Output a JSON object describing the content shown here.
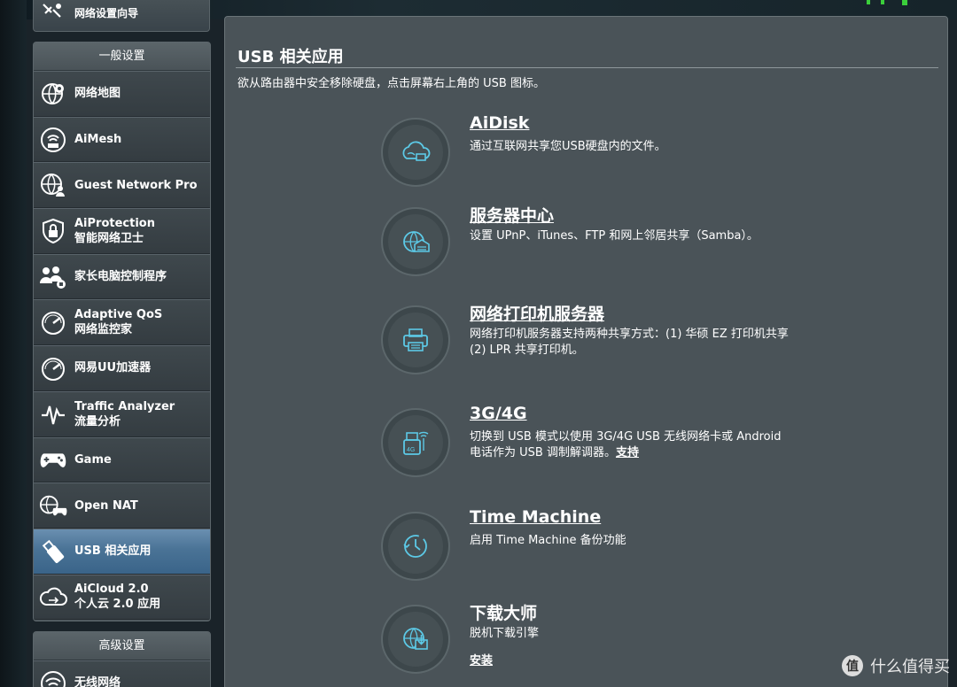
{
  "sidebar": {
    "top_item": {
      "label": "网络设置向导",
      "icon": "wizard-icon"
    },
    "general_header": "一般设置",
    "items": [
      {
        "label": "网络地图",
        "icon": "globe-map-icon"
      },
      {
        "label": "AiMesh",
        "icon": "mesh-router-icon"
      },
      {
        "label": "Guest Network Pro",
        "icon": "guest-globe-icon"
      },
      {
        "label": "AiProtection\n智能网络卫士",
        "icon": "shield-lock-icon"
      },
      {
        "label": "家长电脑控制程序",
        "icon": "family-icon"
      },
      {
        "label": "Adaptive QoS\n网络监控家",
        "icon": "speedometer-icon"
      },
      {
        "label": "网易UU加速器",
        "icon": "speedometer-icon"
      },
      {
        "label": "Traffic Analyzer\n流量分析",
        "icon": "pulse-icon"
      },
      {
        "label": "Game",
        "icon": "gamepad-icon"
      },
      {
        "label": "Open NAT",
        "icon": "gamepad-globe-icon"
      },
      {
        "label": "USB 相关应用",
        "icon": "usb-icon",
        "active": true
      },
      {
        "label": "AiCloud 2.0\n个人云 2.0 应用",
        "icon": "cloud-icon"
      }
    ],
    "advanced_header": "高级设置",
    "advanced_items": [
      {
        "label": "无线网络",
        "icon": "wifi-icon"
      }
    ]
  },
  "main": {
    "title": "USB 相关应用",
    "description": "欲从路由器中安全移除硬盘，点击屏幕右上角的 USB 图标。",
    "apps": [
      {
        "name": "AiDisk",
        "desc": "通过互联网共享您USB硬盘内的文件。",
        "icon": "aidisk-cloud-icon"
      },
      {
        "name": "服务器中心",
        "desc": "设置 UPnP、iTunes、FTP 和网上邻居共享（Samba）。",
        "icon": "server-globe-icon"
      },
      {
        "name": "网络打印机服务器",
        "desc": "网络打印机服务器支持两种共享方式：(1) 华硕 EZ 打印机共享 (2) LPR 共享打印机。",
        "icon": "printer-icon"
      },
      {
        "name": "3G/4G",
        "desc": "切换到 USB 模式以使用 3G/4G USB 无线网络卡或 Android 电话作为 USB 调制解调器。",
        "link": "支持",
        "icon": "usb-4g-icon"
      },
      {
        "name": "Time Machine",
        "desc": "启用 Time Machine 备份功能",
        "icon": "clock-backup-icon"
      },
      {
        "name": "下载大师",
        "desc": "脱机下载引擎",
        "install": "安装",
        "icon": "download-globe-icon"
      }
    ]
  },
  "watermark": {
    "text": "什么值得买",
    "icon_char": "值"
  },
  "colors": {
    "accent": "#5cc9e6",
    "active_item": "#4a7396",
    "panel": "#4a5358"
  }
}
